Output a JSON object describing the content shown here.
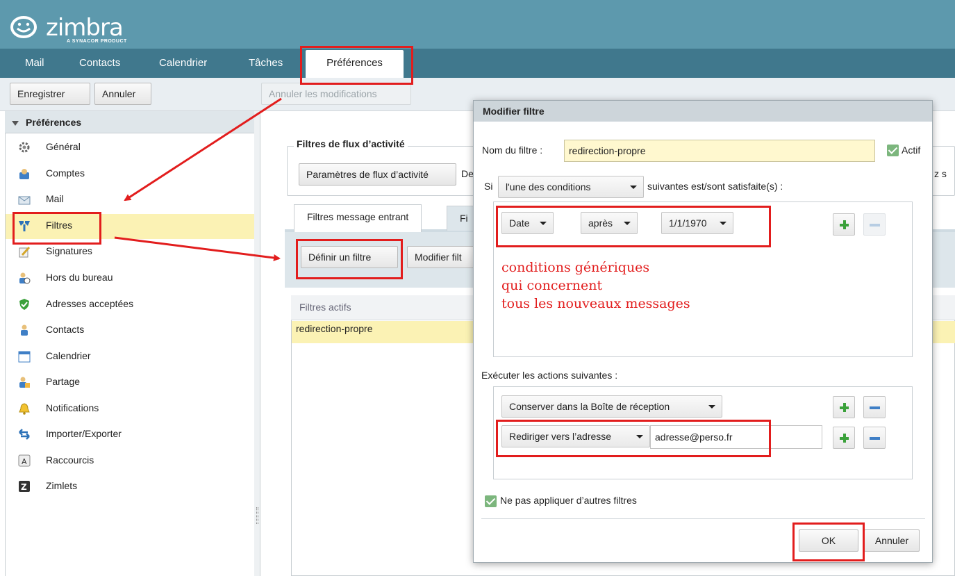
{
  "app": {
    "brand": "zimbra",
    "tagline": "A SYNACOR PRODUCT",
    "tabs": [
      "Mail",
      "Contacts",
      "Calendrier",
      "Tâches",
      "Préférences"
    ]
  },
  "toolbar": {
    "save": "Enregistrer",
    "cancel": "Annuler",
    "undo_changes": "Annuler les modifications"
  },
  "sidebar": {
    "header": "Préférences",
    "items": [
      {
        "label": "Général",
        "icon": "gear-icon"
      },
      {
        "label": "Comptes",
        "icon": "accounts-icon"
      },
      {
        "label": "Mail",
        "icon": "mail-icon"
      },
      {
        "label": "Filtres",
        "icon": "filter-icon"
      },
      {
        "label": "Signatures",
        "icon": "signature-icon"
      },
      {
        "label": "Hors du bureau",
        "icon": "out-of-office-icon"
      },
      {
        "label": "Adresses acceptées",
        "icon": "shield-icon"
      },
      {
        "label": "Contacts",
        "icon": "contact-icon"
      },
      {
        "label": "Calendrier",
        "icon": "calendar-icon"
      },
      {
        "label": "Partage",
        "icon": "sharing-icon"
      },
      {
        "label": "Notifications",
        "icon": "bell-icon"
      },
      {
        "label": "Importer/Exporter",
        "icon": "import-export-icon"
      },
      {
        "label": "Raccourcis",
        "icon": "keyboard-icon"
      },
      {
        "label": "Zimlets",
        "icon": "zimlet-icon"
      }
    ],
    "selected_index": 3
  },
  "main": {
    "flux_legend": "Filtres de flux d’activité",
    "flux_button": "Paramètres de flux d’activité",
    "flux_text_clip": "De",
    "right_clip_text": "z s",
    "subtabs": [
      "Filtres message entrant",
      "Fi"
    ],
    "define_filter": "Définir un filtre",
    "modify_filter_clip": "Modifier filt",
    "active_filters_header": "Filtres actifs",
    "active_filters": [
      "redirection-propre"
    ]
  },
  "dialog": {
    "title": "Modifier filtre",
    "name_label": "Nom du filtre :",
    "name_value": "redirection-propre",
    "active_label": "Actif",
    "si_label": "Si",
    "match_select": "l'une des conditions",
    "match_suffix": "suivantes est/sont satisfaite(s) :",
    "condition": {
      "field": "Date",
      "operator": "après",
      "value": "1/1/1970"
    },
    "actions_label": "Exécuter les actions suivantes :",
    "actions": [
      {
        "type": "Conserver dans la Boîte de réception"
      },
      {
        "type": "Rediriger vers l’adresse",
        "value": "adresse@perso.fr"
      }
    ],
    "stop_label": "Ne pas appliquer d’autres filtres",
    "ok": "OK",
    "cancel": "Annuler"
  },
  "annotation": {
    "text": "conditions génériques\nqui concernent\ntous les nouveaux messages",
    "color": "#e21d1d"
  }
}
